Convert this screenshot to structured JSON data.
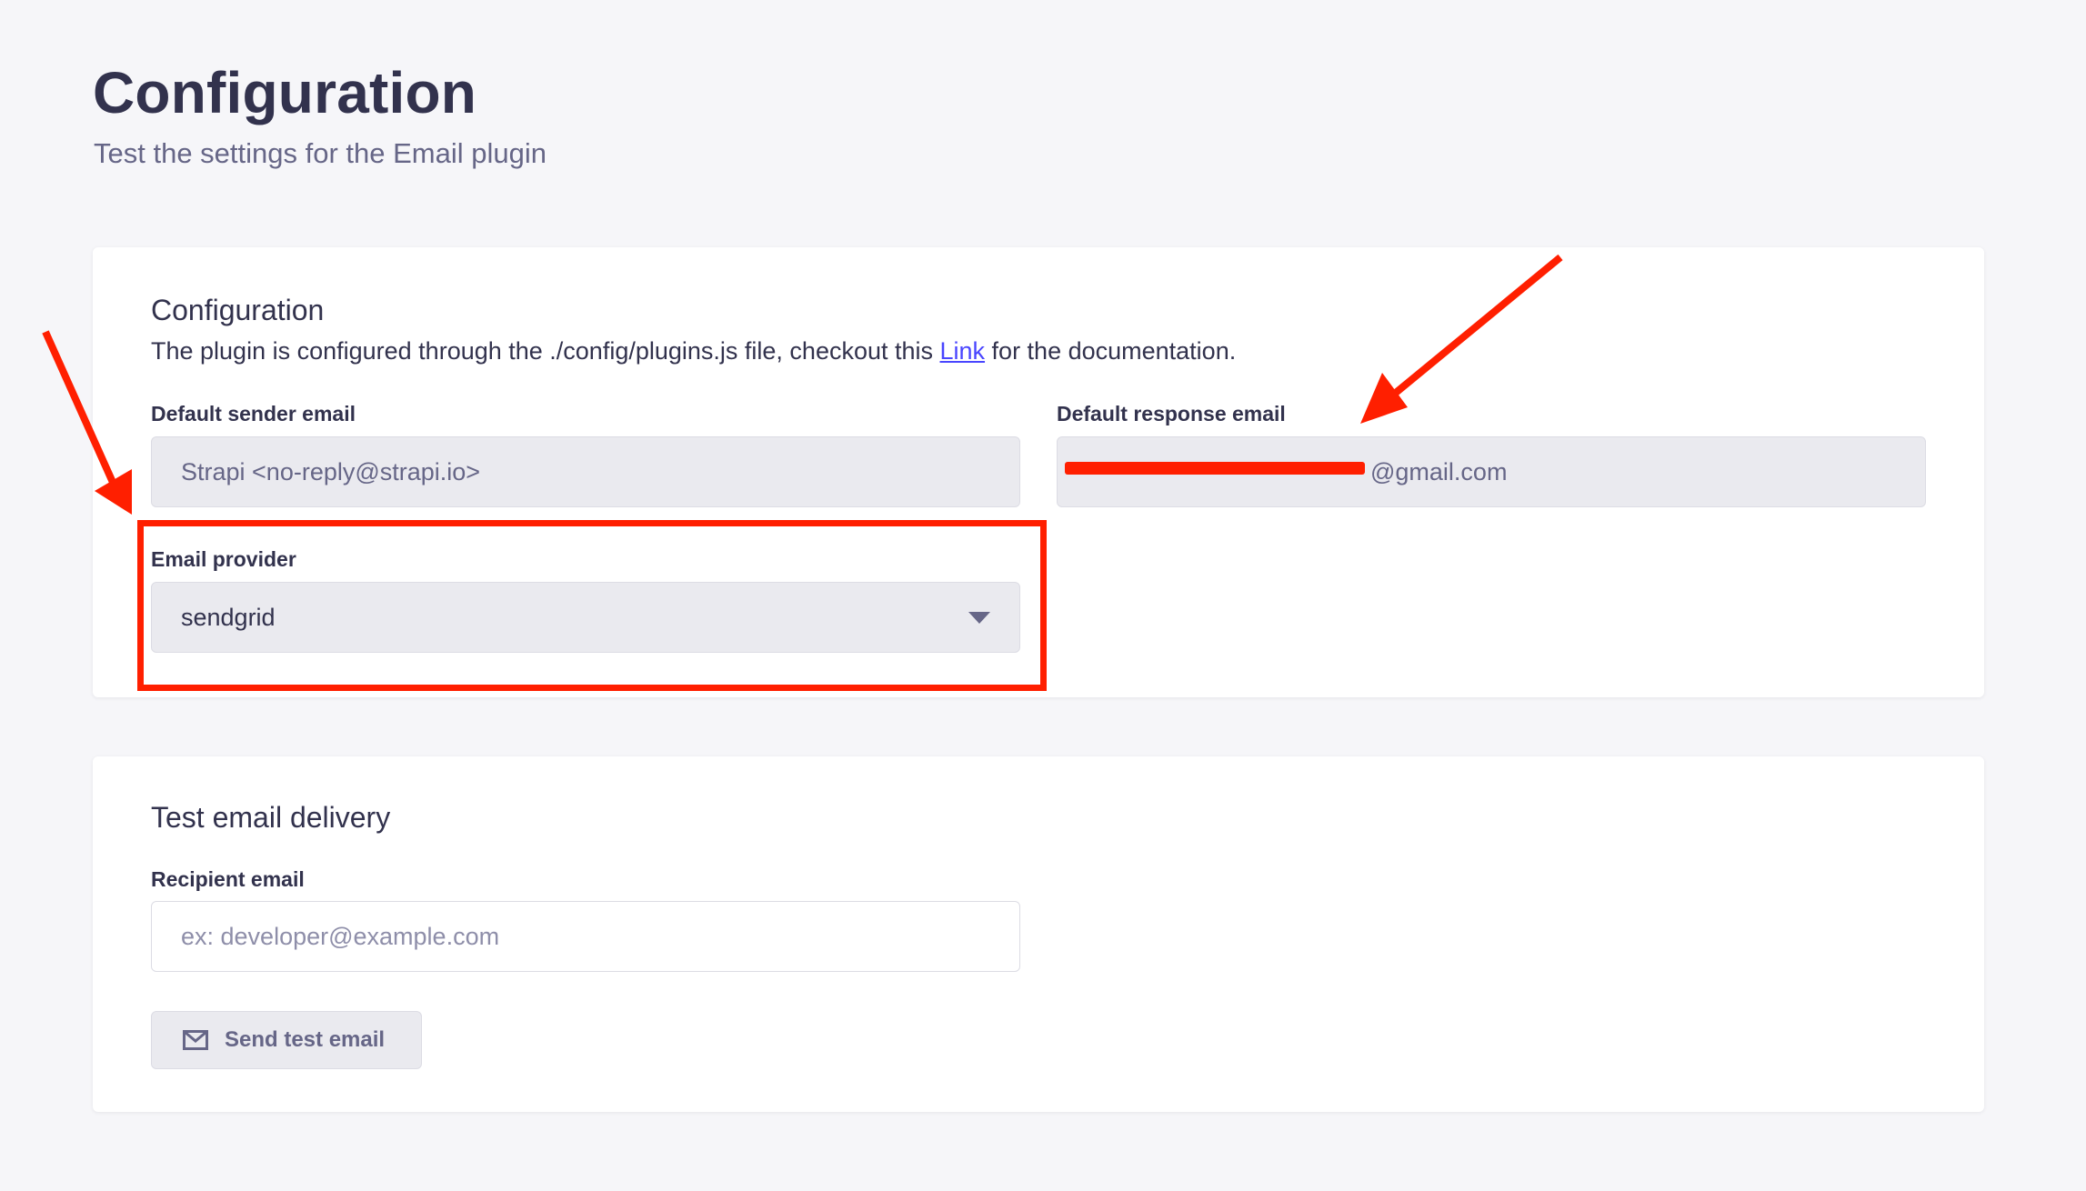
{
  "page": {
    "title": "Configuration",
    "subtitle": "Test the settings for the Email plugin"
  },
  "config_card": {
    "title": "Configuration",
    "description_before_link": "The plugin is configured through the ./config/plugins.js file, checkout this ",
    "link_text": "Link",
    "description_after_link": " for the documentation.",
    "sender_email": {
      "label": "Default sender email",
      "value": "Strapi <no-reply@strapi.io>"
    },
    "response_email": {
      "label": "Default response email",
      "visible_value": "@gmail.com"
    },
    "email_provider": {
      "label": "Email provider",
      "value": "sendgrid"
    }
  },
  "test_card": {
    "title": "Test email delivery",
    "recipient": {
      "label": "Recipient email",
      "placeholder": "ex: developer@example.com"
    },
    "send_button_label": "Send test email"
  },
  "icons": {
    "send_button_icon": "envelope-icon",
    "select_icon": "caret-down-icon"
  },
  "colors": {
    "background": "#f6f6f9",
    "card": "#ffffff",
    "primary_text": "#32324d",
    "secondary_text": "#666687",
    "link": "#4945ff",
    "annotation": "#ff1f00"
  }
}
